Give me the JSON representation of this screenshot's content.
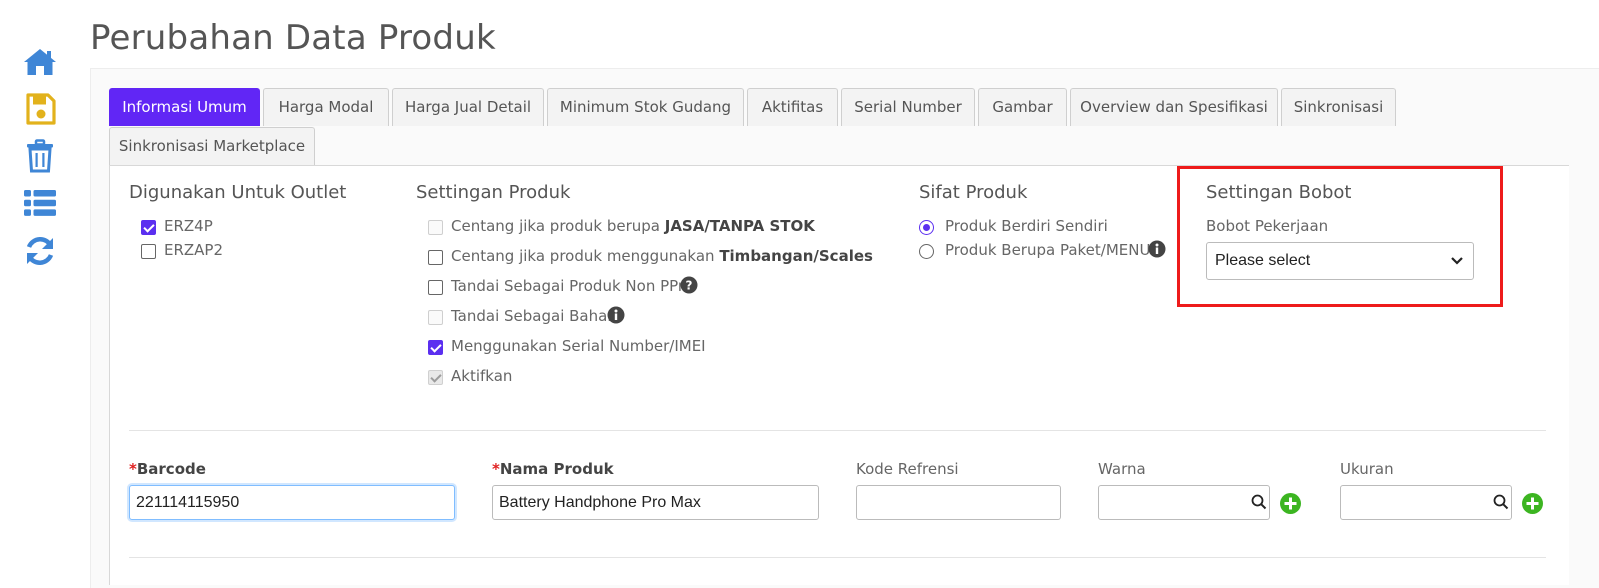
{
  "page_title": "Perubahan Data Produk",
  "sidebar": {
    "icons": [
      "home-icon",
      "save-icon",
      "trash-icon",
      "list-icon",
      "refresh-icon"
    ],
    "colors": {
      "primary": "#3f86d6",
      "save": "#e2b21c"
    }
  },
  "tabs": [
    {
      "label": "Informasi Umum",
      "active": true
    },
    {
      "label": "Harga Modal"
    },
    {
      "label": "Harga Jual Detail"
    },
    {
      "label": "Minimum Stok Gudang"
    },
    {
      "label": "Aktifitas"
    },
    {
      "label": "Serial Number"
    },
    {
      "label": "Gambar"
    },
    {
      "label": "Overview dan Spesifikasi"
    },
    {
      "label": "Sinkronisasi"
    },
    {
      "label": "Sinkronisasi Marketplace"
    }
  ],
  "outlet": {
    "title": "Digunakan Untuk Outlet",
    "items": [
      {
        "label": "ERZ4P",
        "checked": true
      },
      {
        "label": "ERZAP2",
        "checked": false
      }
    ]
  },
  "settings": {
    "title": "Settingan Produk",
    "items": [
      {
        "prefix": "Centang jika produk berupa ",
        "bold": "JASA/TANPA STOK"
      },
      {
        "prefix": "Centang jika produk menggunakan ",
        "bold": "Timbangan/Scales"
      },
      {
        "prefix": "Tandai Sebagai Produk Non PPn"
      },
      {
        "prefix": "Tandai Sebagai Bahan"
      },
      {
        "prefix": "Menggunakan Serial Number/IMEI"
      },
      {
        "prefix": "Aktifkan"
      }
    ]
  },
  "sifat": {
    "title": "Sifat Produk",
    "options": [
      {
        "label": "Produk Berdiri Sendiri",
        "checked": true
      },
      {
        "label": "Produk Berupa Paket/MENU",
        "checked": false
      }
    ]
  },
  "bobot": {
    "title": "Settingan Bobot",
    "label": "Bobot Pekerjaan",
    "selected": "Please select",
    "highlight_color": "#ee1b1b"
  },
  "fields": {
    "barcode": {
      "star": "*",
      "label": "Barcode",
      "value": "221114115950"
    },
    "nama": {
      "star": "*",
      "label": "Nama Produk",
      "value": "Battery Handphone Pro Max"
    },
    "kode": {
      "label": "Kode Refrensi",
      "value": ""
    },
    "warna": {
      "label": "Warna",
      "value": ""
    },
    "ukuran": {
      "label": "Ukuran",
      "value": ""
    }
  },
  "colors": {
    "accent": "#6126f5",
    "add": "#3cb521",
    "required": "#e02020"
  }
}
